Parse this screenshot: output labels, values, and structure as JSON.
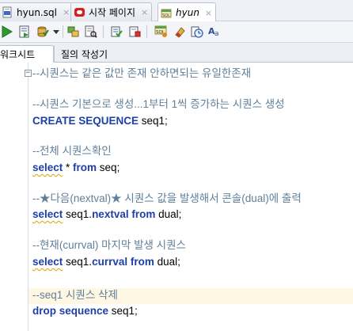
{
  "tabs": [
    {
      "label": "hyun.sql",
      "icon": "sql-file-icon",
      "active": false
    },
    {
      "label": "시작 페이지",
      "icon": "oracle-start-page-icon",
      "active": false
    },
    {
      "label": "hyun",
      "icon": "sql-worksheet-icon",
      "active": true
    }
  ],
  "tab_close_glyph": "×",
  "toolbar_icons": [
    "run-statement-icon",
    "run-script-icon",
    "commit-icon",
    "rollback-dropdown-icon",
    "explain-plan-icon",
    "autotrace-icon",
    "clear-icon",
    "sql-history-icon",
    "sql-tuning-advisor-icon",
    "eraser-icon",
    "history-clock-icon",
    "format-text-icon"
  ],
  "subtabs": {
    "worksheet": "워크시트",
    "query_builder": "질의 작성기"
  },
  "editor": {
    "fold_glyph": "−",
    "lines": [
      {
        "type": "comment",
        "text": "--시퀀스는 같은 값만 존재 안하면되는 유일한존재"
      },
      {
        "type": "comment",
        "text": "--시퀀스 기본으로 생성...1부터 1씩 증가하는 시퀀스 생성"
      },
      {
        "type": "code",
        "kw1": "CREATE SEQUENCE",
        "rest": " seq1;"
      },
      {
        "type": "comment",
        "text": "--전체 시퀀스확인"
      },
      {
        "type": "code",
        "kw1": "select",
        "mid": " * ",
        "kw2": "from",
        "rest": " seq;"
      },
      {
        "type": "comment",
        "text": "--★다음(nextval)★ 시퀀스 값을 발생해서 콘솔(dual)에 출력"
      },
      {
        "type": "code",
        "kw1": "select",
        "mid": " seq1.",
        "kw2": "nextval",
        "mid2": " ",
        "kw3": "from",
        "rest": " dual;"
      },
      {
        "type": "comment",
        "text": "--현재(currval) 마지막 발생 시퀀스"
      },
      {
        "type": "code",
        "kw1": "select",
        "mid": " seq1.",
        "kw2": "currval",
        "mid2": " ",
        "kw3": "from",
        "rest": " dual;"
      },
      {
        "type": "comment",
        "text": "--seq1 시퀀스 삭제"
      },
      {
        "type": "code",
        "kw1": "drop sequence",
        "rest": " seq1;"
      }
    ]
  },
  "colors": {
    "keyword": "#1d3fa8",
    "comment": "#607f9a",
    "current_line": "#fdf7e3"
  }
}
